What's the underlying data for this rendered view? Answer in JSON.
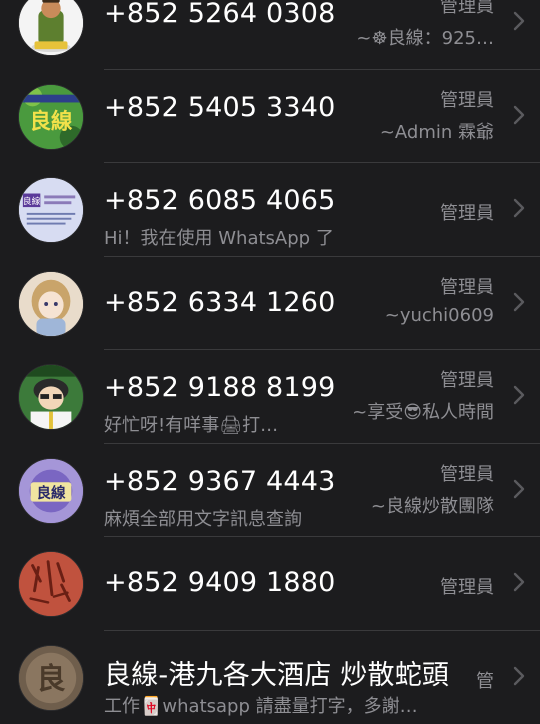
{
  "contacts": [
    {
      "name": "+852 5264 0308",
      "badge": "管理員",
      "subtitle": "~☸良線：925…",
      "status": "",
      "avatar_icon": "cartoon-figure-avatar"
    },
    {
      "name": "+852 5405 3340",
      "badge": "管理員",
      "subtitle": "~Admin 霖爺",
      "status": "",
      "avatar_icon": "liangxian-logo-avatar",
      "avatar_text": "良線"
    },
    {
      "name": "+852 6085 4065",
      "badge": "管理員",
      "subtitle": "",
      "status": "Hi！我在使用 WhatsApp 了。",
      "avatar_icon": "business-card-avatar",
      "avatar_text": "良線"
    },
    {
      "name": "+852 6334 1260",
      "badge": "管理員",
      "subtitle": "~yuchi0609",
      "status": "",
      "avatar_icon": "anime-girl-avatar"
    },
    {
      "name": "+852 9188 8199",
      "badge": "管理員",
      "subtitle": "~享受😎私人時間",
      "status": "好忙呀!有咩事🖨打…",
      "avatar_icon": "cartoon-boy-avatar"
    },
    {
      "name": "+852 9367 4443",
      "badge": "管理員",
      "subtitle": "~良線炒散團隊",
      "status": "麻煩全部用文字訊息查詢",
      "avatar_icon": "liangxian-purple-avatar",
      "avatar_text": "良線"
    },
    {
      "name": "+852 9409 1880",
      "badge": "管理員",
      "subtitle": "",
      "status": "",
      "avatar_icon": "calligraphy-avatar"
    },
    {
      "name": "良線-港九各大酒店 炒散蛇頭",
      "badge": "管",
      "subtitle": "",
      "status": "工作🀄whatsapp 請盡量打字，多謝…",
      "avatar_icon": "stone-carving-avatar",
      "avatar_text": "良"
    }
  ],
  "colors": {
    "background": "#1c1c1e",
    "separator": "#3a3a3c",
    "primary_text": "#ffffff",
    "secondary_text": "#8e8e93"
  }
}
